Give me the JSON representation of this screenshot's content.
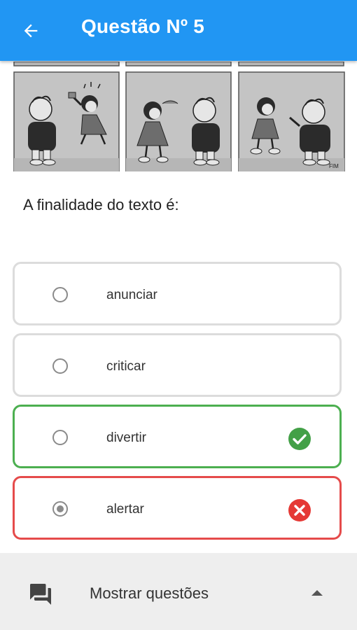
{
  "header": {
    "title": "Questão Nº 5",
    "back_icon": "arrow-left-icon",
    "bg_color": "#2196f3"
  },
  "comic": {
    "signature": "FIM"
  },
  "question": {
    "text": "A finalidade do texto é:"
  },
  "options": [
    {
      "label": "anunciar",
      "selected": false,
      "status": "none"
    },
    {
      "label": "criticar",
      "selected": false,
      "status": "none"
    },
    {
      "label": "divertir",
      "selected": false,
      "status": "correct"
    },
    {
      "label": "alertar",
      "selected": true,
      "status": "wrong"
    }
  ],
  "status_colors": {
    "correct": "#43a047",
    "wrong": "#e53935"
  },
  "footer": {
    "label": "Mostrar questões",
    "icon": "forum-icon",
    "toggle_icon": "caret-up-icon"
  }
}
